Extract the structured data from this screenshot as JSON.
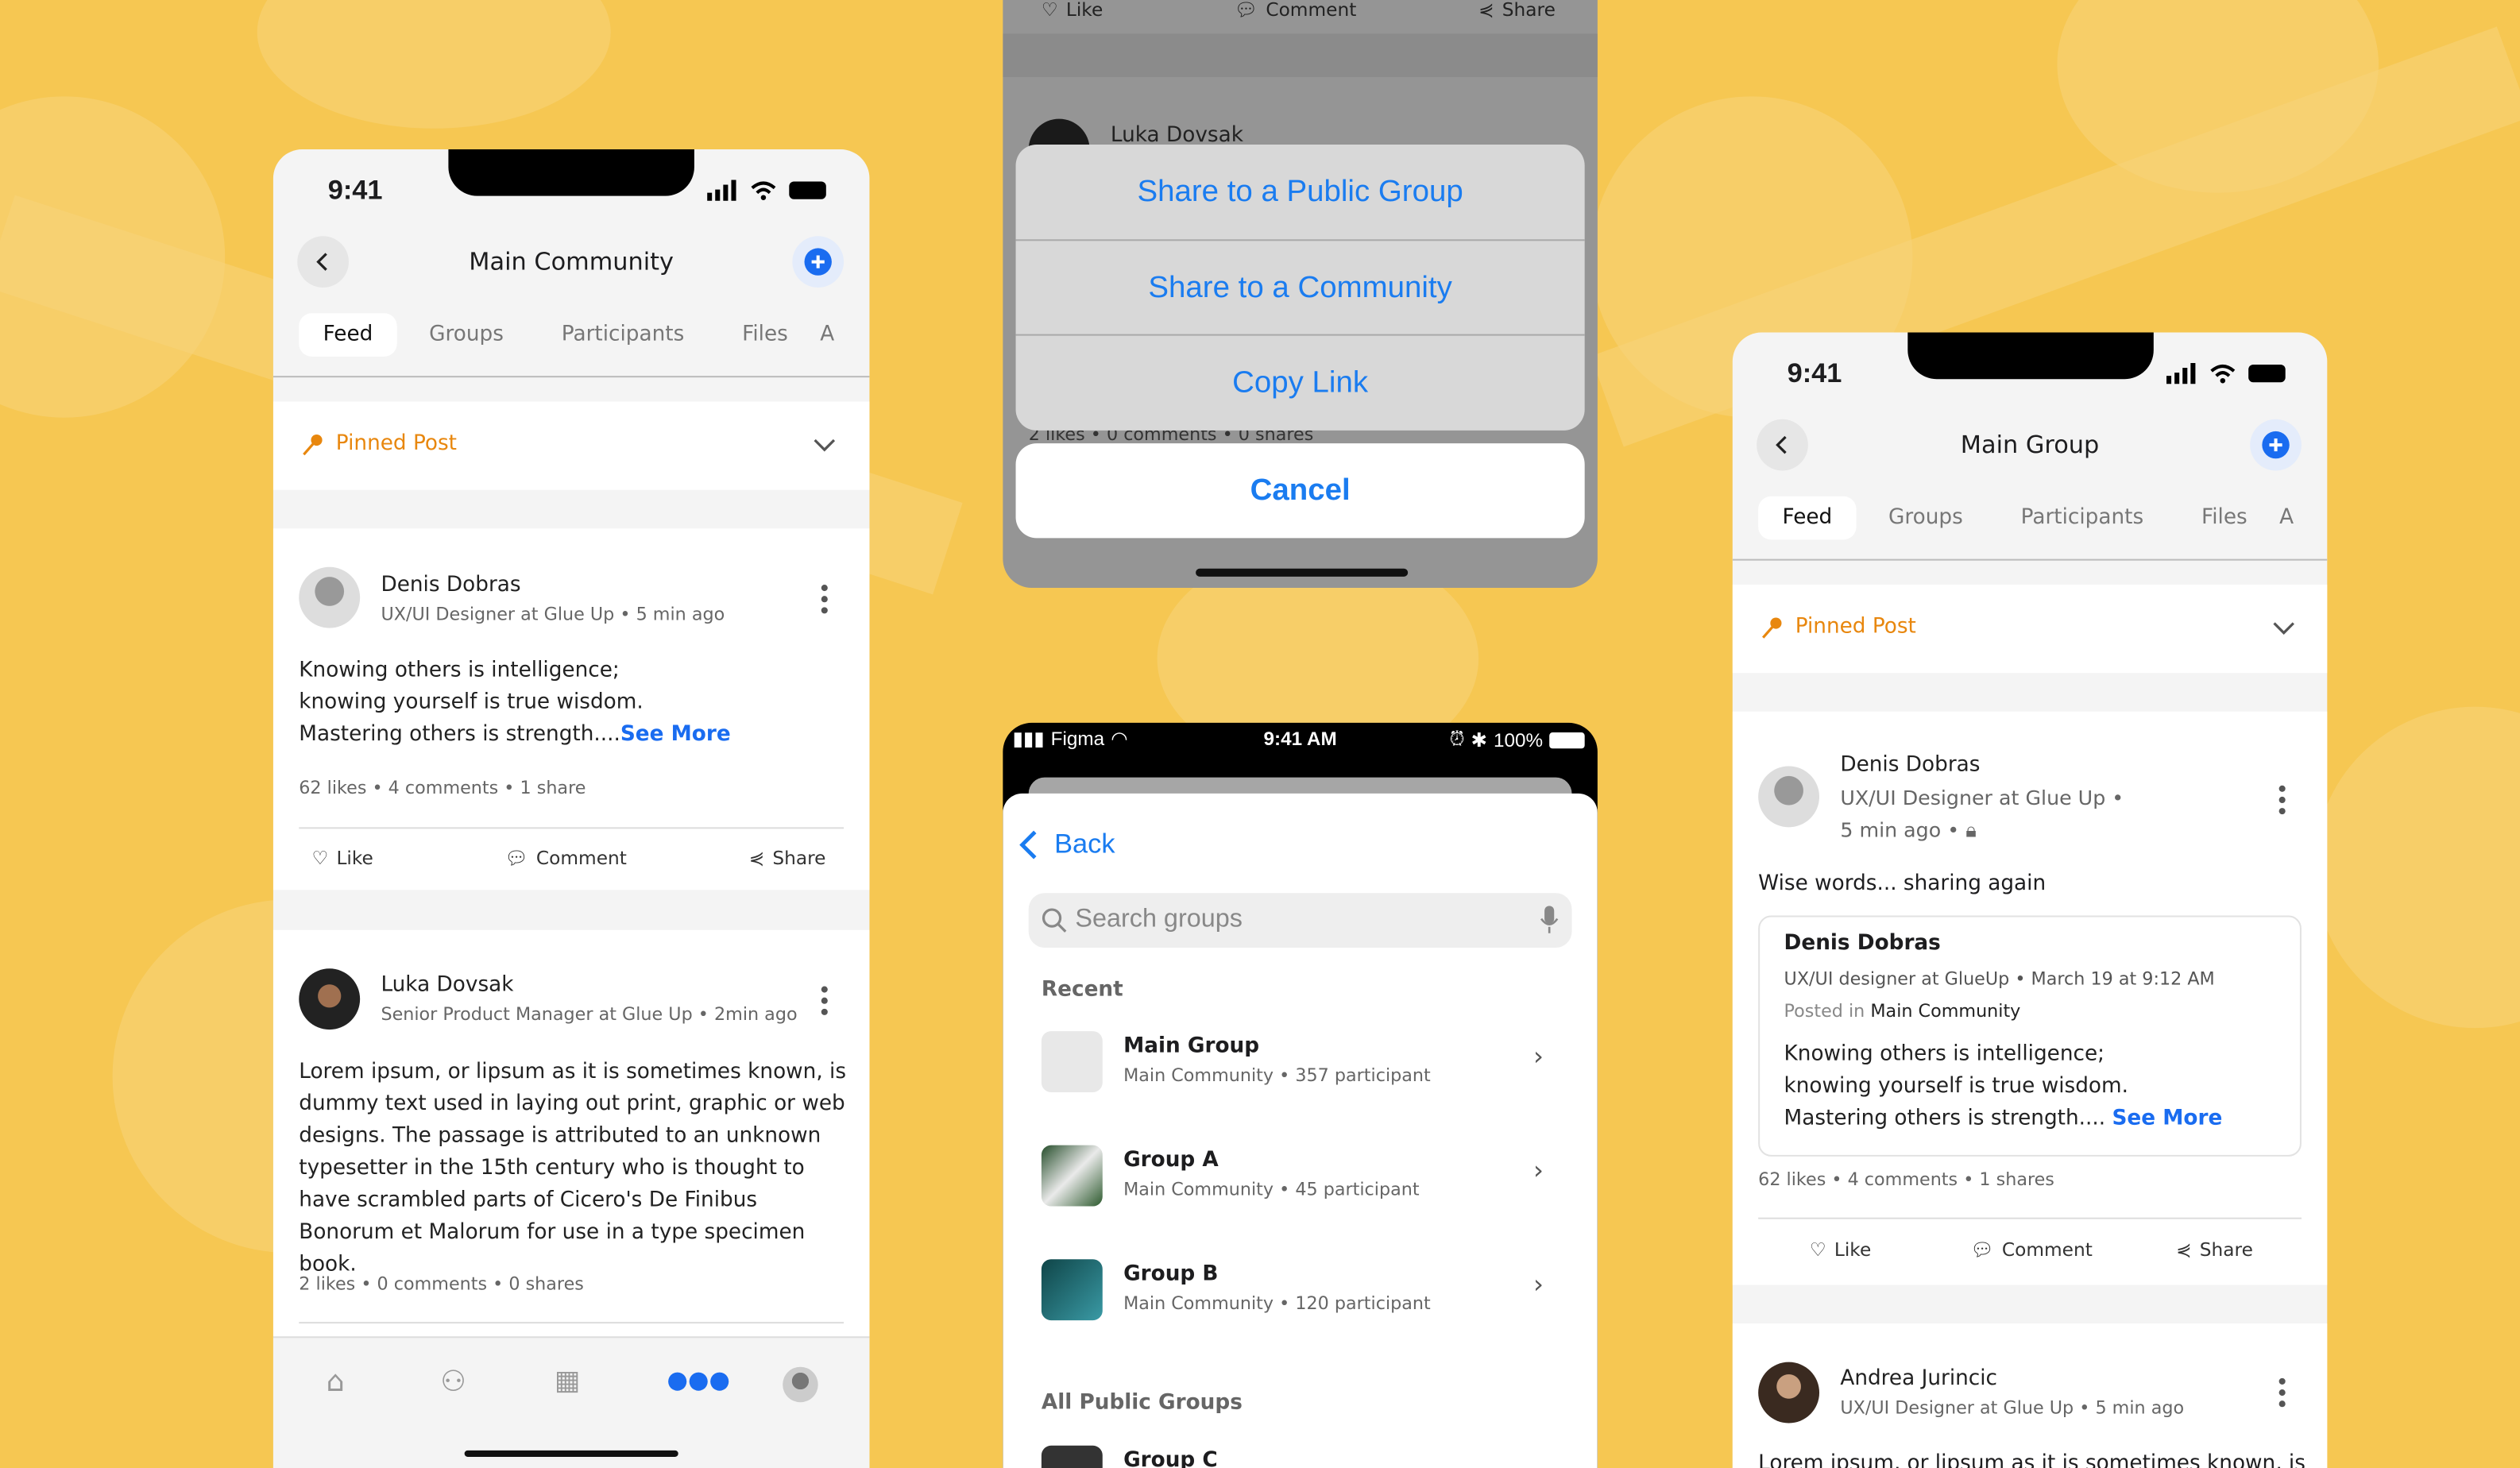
{
  "colors": {
    "background": "#F6C752",
    "accent_blue": "#1a6cf0",
    "pinned_orange": "#E8870E",
    "ios_blue": "#1a7cf0"
  },
  "status_time": "9:41",
  "community_screen": {
    "title": "Main Community",
    "tabs": [
      "Feed",
      "Groups",
      "Participants",
      "Files",
      "A"
    ],
    "pinned_label": "Pinned Post",
    "posts": [
      {
        "author": "Denis Dobras",
        "meta": "UX/UI Designer at Glue Up  •  5 min ago",
        "lines": [
          "Knowing others is intelligence;",
          "knowing yourself is true wisdom.",
          "Mastering others is strength...."
        ],
        "see_more": "See More",
        "stats": "62 likes  •  4 comments  •  1 share"
      },
      {
        "author": "Luka Dovsak",
        "meta": "Senior Product Manager at Glue Up  •  2min ago",
        "body": "Lorem ipsum, or lipsum as it is sometimes known, is dummy text used in laying out print, graphic or web designs. The passage is attributed to an unknown typesetter in the 15th century who is thought to have scrambled parts of Cicero's De Finibus Bonorum et Malorum for use in a type specimen book.",
        "stats": "2 likes  •  0 comments  •  0 shares"
      }
    ],
    "actions": {
      "like": "Like",
      "comment": "Comment",
      "share": "Share"
    },
    "tabbar": [
      "home-icon",
      "network-icon",
      "calendar-icon",
      "groups-icon",
      "profile-avatar"
    ]
  },
  "share_sheet": {
    "bg_actions": {
      "like": "Like",
      "comment": "Comment",
      "share": "Share"
    },
    "bg_author": "Luka Dovsak",
    "bg_stats": "2 likes  •  0 comments  •  0 shares",
    "options": [
      "Share to a Public Group",
      "Share to a Community",
      "Copy Link"
    ],
    "cancel": "Cancel"
  },
  "group_picker": {
    "status": {
      "carrier": "Figma",
      "time": "9:41 AM",
      "battery": "100%"
    },
    "back": "Back",
    "search_placeholder": "Search groups",
    "recent_label": "Recent",
    "recent": [
      {
        "name": "Main Group",
        "meta": "Main Community • 357 participant"
      },
      {
        "name": "Group A",
        "meta": "Main Community • 45 participant"
      },
      {
        "name": "Group B",
        "meta": "Main Community • 120 participant"
      }
    ],
    "all_label": "All Public Groups",
    "all": [
      {
        "name": "Group C"
      }
    ]
  },
  "group_screen": {
    "title": "Main Group",
    "tabs": [
      "Feed",
      "Groups",
      "Participants",
      "Files",
      "A"
    ],
    "pinned_label": "Pinned Post",
    "post": {
      "author": "Denis Dobras",
      "meta1": "UX/UI Designer at Glue Up  •",
      "meta2": "5 min ago  •",
      "text": "Wise words... sharing again",
      "shared": {
        "author": "Denis Dobras",
        "meta": "UX/UI designer at GlueUp • March 19 at 9:12 AM",
        "posted_in_label": "Posted in",
        "posted_in": "Main Community",
        "lines": [
          "Knowing others is intelligence;",
          "knowing yourself is true wisdom.",
          "Mastering others is strength...."
        ],
        "see_more": "See More"
      },
      "stats": "62 likes  •  4 comments  •  1 shares"
    },
    "actions": {
      "like": "Like",
      "comment": "Comment",
      "share": "Share"
    },
    "post2": {
      "author": "Andrea Jurincic",
      "meta": "UX/UI Designer at Glue Up  •  5 min ago",
      "body": "Lorem ipsum, or lipsum as it is sometimes known, is"
    }
  }
}
